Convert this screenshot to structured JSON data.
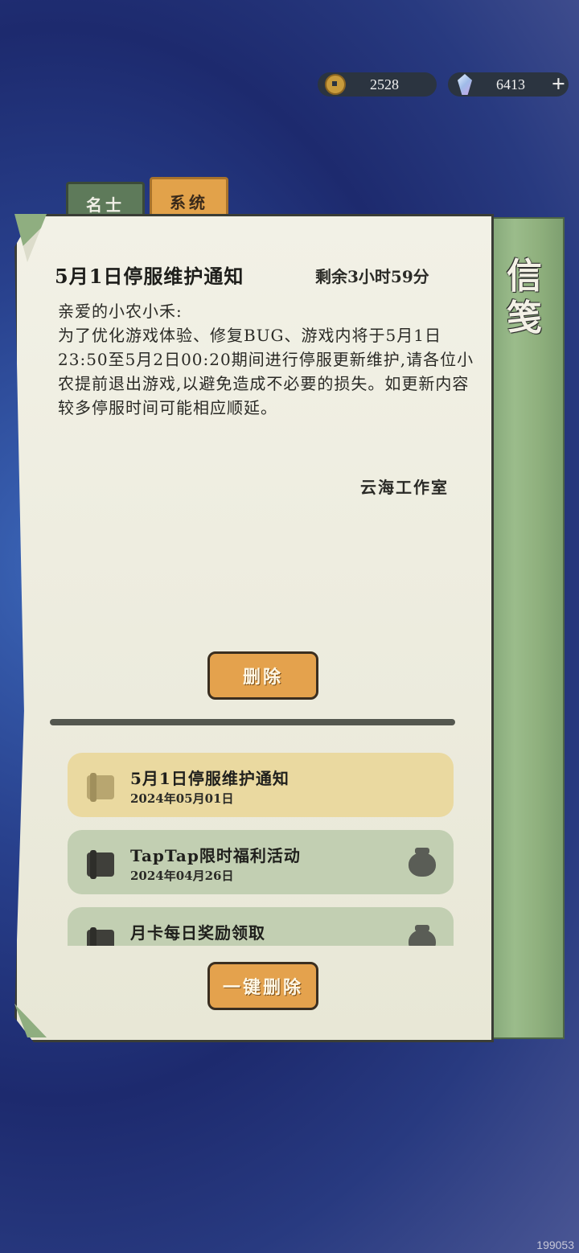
{
  "currency": {
    "coins": "2528",
    "gems": "6413"
  },
  "tabs": {
    "mingshi": "名士",
    "xitong": "系统"
  },
  "side_title": "信笺",
  "notice": {
    "title": "5月1日停服维护通知",
    "remaining": "剩余3小时59分",
    "body": [
      "亲爱的小农小禾:",
      "为了优化游戏体验、修复BUG、游戏内将于5月1日23:50至5月2日00:20期间进行停服更新维护,请各位小农提前退出游戏,以避免造成不必要的损失。如更新内容较多停服时间可能相应顺延。"
    ],
    "signature": "云海工作室",
    "delete_label": "删除"
  },
  "mail_list": [
    {
      "title": "5月1日停服维护通知",
      "date": "2024年05月01日"
    },
    {
      "title": "TapTap限时福利活动",
      "date": "2024年04月26日"
    },
    {
      "title": "月卡每日奖励领取",
      "date": ""
    }
  ],
  "delete_all_label": "一键删除",
  "watermark": "199053"
}
